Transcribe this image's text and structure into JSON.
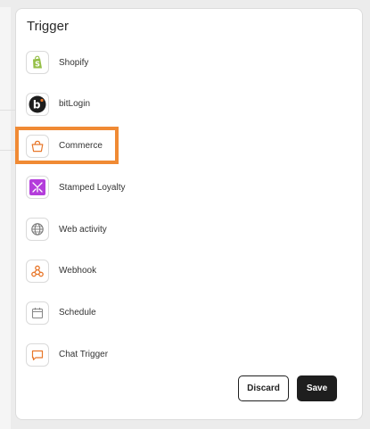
{
  "dialog": {
    "title": "Trigger",
    "triggers": [
      {
        "label": "Shopify",
        "icon": "shopify-icon"
      },
      {
        "label": "bitLogin",
        "icon": "bitlogin-icon"
      },
      {
        "label": "Commerce",
        "icon": "basket-icon"
      },
      {
        "label": "Stamped Loyalty",
        "icon": "stamped-icon"
      },
      {
        "label": "Web activity",
        "icon": "globe-icon"
      },
      {
        "label": "Webhook",
        "icon": "webhook-icon"
      },
      {
        "label": "Schedule",
        "icon": "calendar-icon"
      },
      {
        "label": "Chat Trigger",
        "icon": "chat-bubble-icon"
      }
    ],
    "highlighted_trigger": "Commerce",
    "buttons": {
      "discard_label": "Discard",
      "save_label": "Save"
    }
  },
  "colors": {
    "highlight": "#f08a34",
    "shopify_green": "#95bf47",
    "accent_orange": "#e8772a",
    "stamped_purple": "#b43ddb",
    "save_bg": "#1e1e1e"
  }
}
